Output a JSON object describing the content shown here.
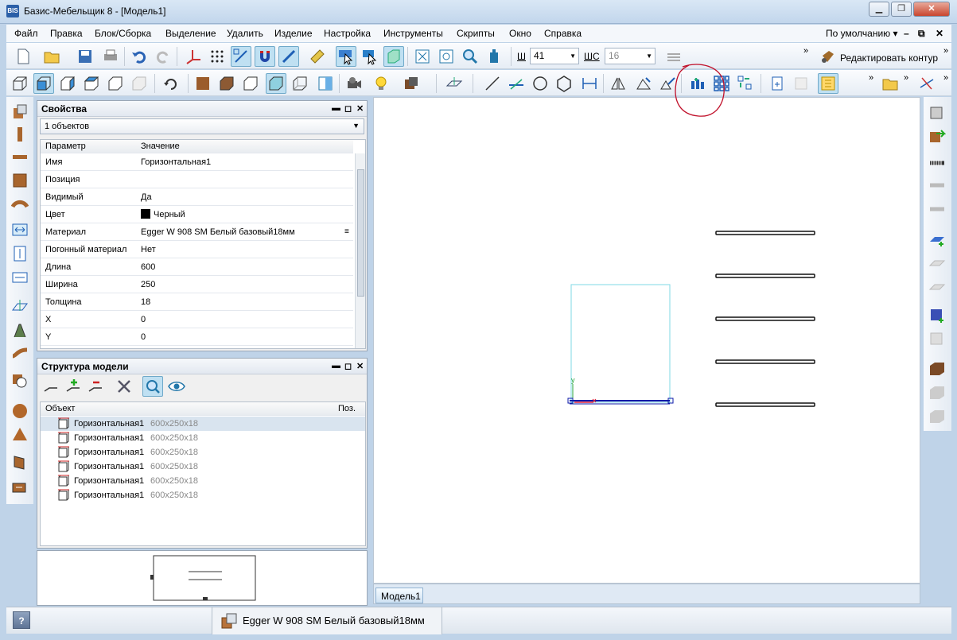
{
  "window": {
    "title": "Базис-Мебельщик 8 - [Модель1]",
    "app_icon": "BIS"
  },
  "menu": {
    "items": [
      "Файл",
      "Правка",
      "Блок/Сборка",
      "Выделение",
      "Удалить",
      "Изделие",
      "Настройка",
      "Инструменты",
      "Скрипты",
      "Окно",
      "Справка"
    ],
    "workspace": "По умолчанию"
  },
  "toolbar1": {
    "w_label": "Ш",
    "w_value": "41",
    "h_label": "ШС",
    "h_value": "16",
    "edit_contour": "Редактировать контур"
  },
  "properties": {
    "title": "Свойства",
    "selection": "1 объектов",
    "columns": [
      "Параметр",
      "Значение"
    ],
    "rows": [
      {
        "name": "Имя",
        "value": "Горизонтальная1"
      },
      {
        "name": "Позиция",
        "value": ""
      },
      {
        "name": "Видимый",
        "value": "Да"
      },
      {
        "name": "Цвет",
        "value": "Черный"
      },
      {
        "name": "Материал",
        "value": "Egger W 908 SM Белый базовый18мм"
      },
      {
        "name": "Погонный материал",
        "value": "Нет"
      },
      {
        "name": "Длина",
        "value": "600"
      },
      {
        "name": "Ширина",
        "value": "250"
      },
      {
        "name": "Толщина",
        "value": "18"
      },
      {
        "name": "X",
        "value": "0"
      },
      {
        "name": "Y",
        "value": "0"
      }
    ],
    "color_swatch": "#000000"
  },
  "structure": {
    "title": "Структура модели",
    "columns": [
      "Объект",
      "Поз."
    ],
    "items": [
      {
        "name": "Горизонтальная1",
        "size": "600x250x18"
      },
      {
        "name": "Горизонтальная1",
        "size": "600x250x18"
      },
      {
        "name": "Горизонтальная1",
        "size": "600x250x18"
      },
      {
        "name": "Горизонтальная1",
        "size": "600x250x18"
      },
      {
        "name": "Горизонтальная1",
        "size": "600x250x18"
      },
      {
        "name": "Горизонтальная1",
        "size": "600x250x18"
      }
    ]
  },
  "viewport": {
    "tab": "Модель1",
    "axis_label": "y"
  },
  "status": {
    "help": "?",
    "material": "Egger W 908 SM Белый базовый18мм"
  },
  "colors": {
    "accent": "#1e90ff",
    "selection_frame": "#7fd8e6",
    "annotation": "#c0102a"
  }
}
